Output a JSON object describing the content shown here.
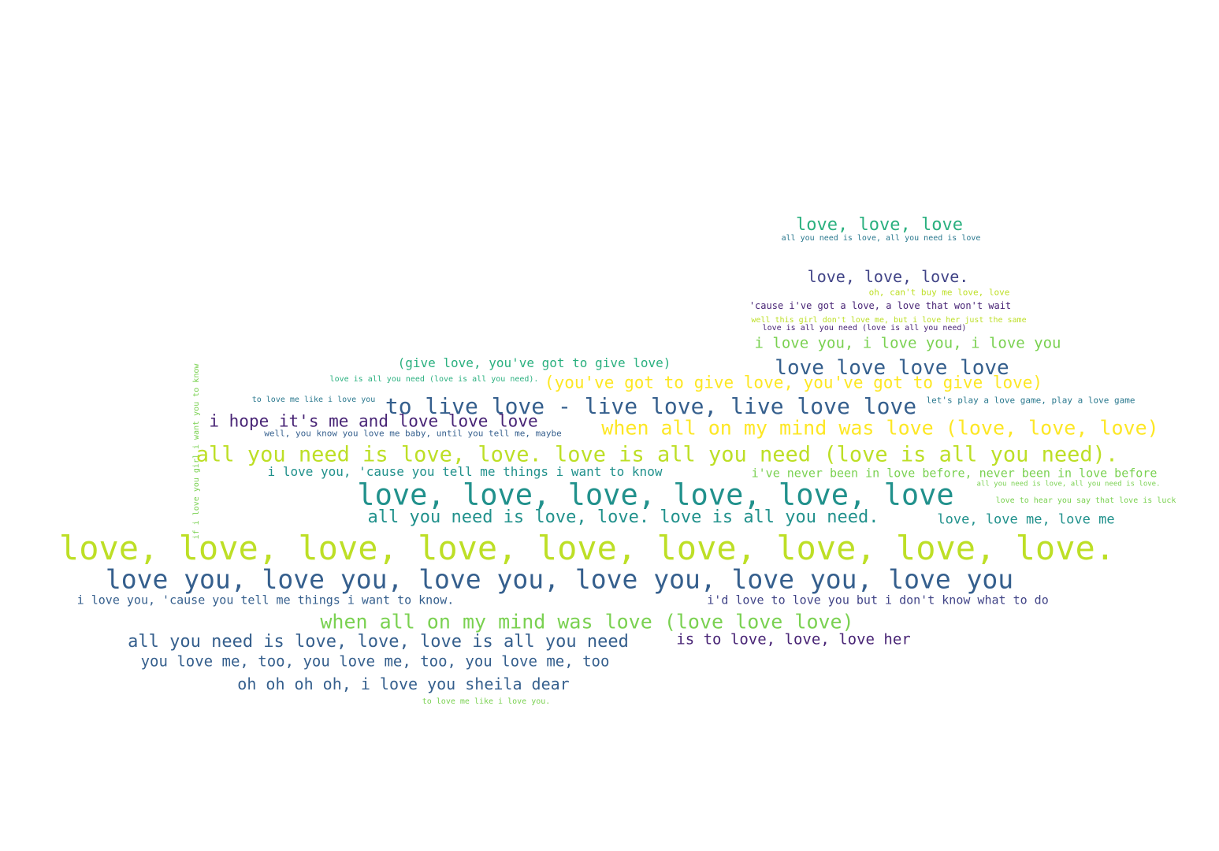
{
  "palette": {
    "purple": "#482475",
    "indigo": "#414487",
    "blue": "#355f8d",
    "teal": "#2a788e",
    "sea": "#21918c",
    "green": "#2ab07f",
    "lime": "#7ad151",
    "chartreuse": "#bddf26",
    "yellow": "#fde725"
  },
  "phrases": [
    {
      "text": "love, love, love"
    },
    {
      "text": "all you need is love, all you need is love"
    },
    {
      "text": "love, love, love."
    },
    {
      "text": "oh, can't buy me love, love"
    },
    {
      "text": "'cause i've got a love, a love that won't wait"
    },
    {
      "text": "well this girl don't love me, but i love her just the same"
    },
    {
      "text": "love is all you need (love is all you need)"
    },
    {
      "text": "i love you, i love you, i love you"
    },
    {
      "text": "(give love, you've got to give love)"
    },
    {
      "text": "love love love love"
    },
    {
      "text": "love is all you need (love is all you need)."
    },
    {
      "text": "(you've got to give love, you've got to give love)"
    },
    {
      "text": "to love me like i love you"
    },
    {
      "text": "let's play a love game, play a love game"
    },
    {
      "text": "to live love - live love, live love love"
    },
    {
      "text": "i hope it's me and love love love"
    },
    {
      "text": "when all on my mind was love (love, love, love)"
    },
    {
      "text": "well, you know you love me baby, until you tell me, maybe"
    },
    {
      "text": "if i love you girl i want you to know"
    },
    {
      "text": "all you need is love, love. love is all you need (love is all you need)."
    },
    {
      "text": "i love you, 'cause you tell me things i want to know"
    },
    {
      "text": "i've never been in love before, never been in love before"
    },
    {
      "text": "all you need is love, all you need is love."
    },
    {
      "text": "love, love, love, love, love, love"
    },
    {
      "text": "love to hear you say that love is luck"
    },
    {
      "text": "all you need is love, love. love is all you need."
    },
    {
      "text": "love, love me, love me"
    },
    {
      "text": "love, love, love, love, love, love, love, love, love."
    },
    {
      "text": "love you, love you, love you, love you, love you, love you"
    },
    {
      "text": "i love you, 'cause you tell me things i want to know."
    },
    {
      "text": "i'd love to love you but i don't know what to do"
    },
    {
      "text": "when all on my mind was love (love love love)"
    },
    {
      "text": "all you need is love, love, love is all you need"
    },
    {
      "text": "is to love, love, love her"
    },
    {
      "text": "you love me, too, you love me, too, you love me, too"
    },
    {
      "text": "oh oh oh oh, i love you sheila dear"
    },
    {
      "text": "to love me like i love you."
    }
  ]
}
